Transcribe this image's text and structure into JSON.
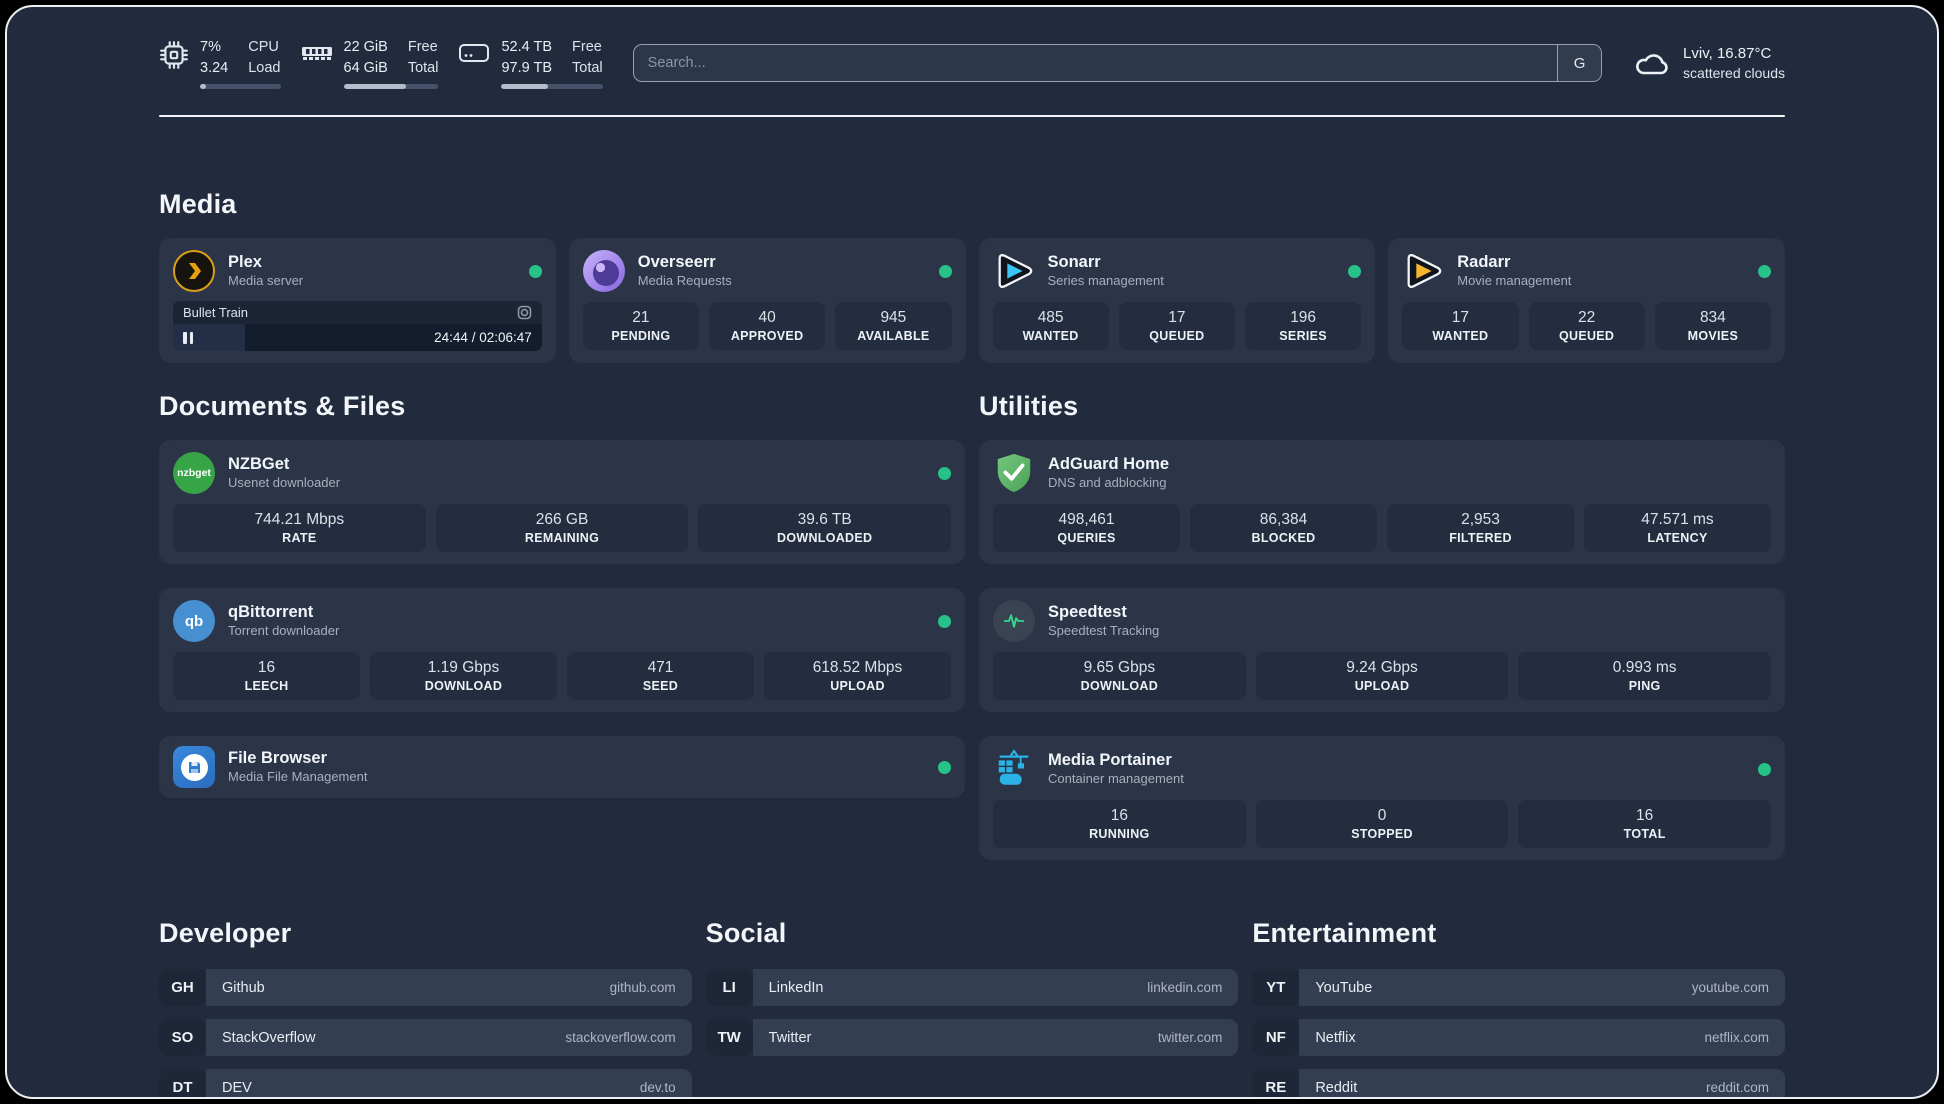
{
  "topbar": {
    "cpu": {
      "value1": "7%",
      "value2": "3.24",
      "label1": "CPU",
      "label2": "Load",
      "progress": 7
    },
    "ram": {
      "value1": "22 GiB",
      "value2": "64 GiB",
      "label1": "Free",
      "label2": "Total",
      "progress": 66
    },
    "disk": {
      "value1": "52.4 TB",
      "value2": "97.9 TB",
      "label1": "Free",
      "label2": "Total",
      "progress": 46
    },
    "search": {
      "placeholder": "Search...",
      "engine_label": "G"
    },
    "weather": {
      "location_temp": "Lviv, 16.87°C",
      "condition": "scattered clouds"
    }
  },
  "sections": {
    "media": {
      "title": "Media",
      "apps": [
        {
          "name": "Plex",
          "desc": "Media server",
          "status": "online",
          "player": {
            "title": "Bullet Train",
            "time": "24:44 / 02:06:47",
            "progress": 19.5
          }
        },
        {
          "name": "Overseerr",
          "desc": "Media Requests",
          "status": "online",
          "stats": [
            {
              "value": "21",
              "label": "PENDING"
            },
            {
              "value": "40",
              "label": "APPROVED"
            },
            {
              "value": "945",
              "label": "AVAILABLE"
            }
          ]
        },
        {
          "name": "Sonarr",
          "desc": "Series management",
          "status": "online",
          "stats": [
            {
              "value": "485",
              "label": "WANTED"
            },
            {
              "value": "17",
              "label": "QUEUED"
            },
            {
              "value": "196",
              "label": "SERIES"
            }
          ]
        },
        {
          "name": "Radarr",
          "desc": "Movie management",
          "status": "online",
          "stats": [
            {
              "value": "17",
              "label": "WANTED"
            },
            {
              "value": "22",
              "label": "QUEUED"
            },
            {
              "value": "834",
              "label": "MOVIES"
            }
          ]
        }
      ]
    },
    "documents": {
      "title": "Documents & Files",
      "apps": [
        {
          "name": "NZBGet",
          "desc": "Usenet downloader",
          "status": "online",
          "stats": [
            {
              "value": "744.21 Mbps",
              "label": "RATE"
            },
            {
              "value": "266 GB",
              "label": "REMAINING"
            },
            {
              "value": "39.6 TB",
              "label": "DOWNLOADED"
            }
          ]
        },
        {
          "name": "qBittorrent",
          "desc": "Torrent downloader",
          "status": "online",
          "stats": [
            {
              "value": "16",
              "label": "LEECH"
            },
            {
              "value": "1.19 Gbps",
              "label": "DOWNLOAD"
            },
            {
              "value": "471",
              "label": "SEED"
            },
            {
              "value": "618.52 Mbps",
              "label": "UPLOAD"
            }
          ]
        },
        {
          "name": "File Browser",
          "desc": "Media File Management",
          "status": "online",
          "stats": []
        }
      ]
    },
    "utilities": {
      "title": "Utilities",
      "apps": [
        {
          "name": "AdGuard Home",
          "desc": "DNS and adblocking",
          "stats": [
            {
              "value": "498,461",
              "label": "QUERIES"
            },
            {
              "value": "86,384",
              "label": "BLOCKED"
            },
            {
              "value": "2,953",
              "label": "FILTERED"
            },
            {
              "value": "47.571 ms",
              "label": "LATENCY"
            }
          ]
        },
        {
          "name": "Speedtest",
          "desc": "Speedtest Tracking",
          "stats": [
            {
              "value": "9.65 Gbps",
              "label": "DOWNLOAD"
            },
            {
              "value": "9.24 Gbps",
              "label": "UPLOAD"
            },
            {
              "value": "0.993 ms",
              "label": "PING"
            }
          ]
        },
        {
          "name": "Media Portainer",
          "desc": "Container management",
          "status": "online",
          "stats": [
            {
              "value": "16",
              "label": "RUNNING"
            },
            {
              "value": "0",
              "label": "STOPPED"
            },
            {
              "value": "16",
              "label": "TOTAL"
            }
          ]
        }
      ]
    },
    "bookmarks": [
      {
        "title": "Developer",
        "links": [
          {
            "abbr": "GH",
            "name": "Github",
            "url": "github.com"
          },
          {
            "abbr": "SO",
            "name": "StackOverflow",
            "url": "stackoverflow.com"
          },
          {
            "abbr": "DT",
            "name": "DEV",
            "url": "dev.to"
          }
        ]
      },
      {
        "title": "Social",
        "links": [
          {
            "abbr": "LI",
            "name": "LinkedIn",
            "url": "linkedin.com"
          },
          {
            "abbr": "TW",
            "name": "Twitter",
            "url": "twitter.com"
          }
        ]
      },
      {
        "title": "Entertainment",
        "links": [
          {
            "abbr": "YT",
            "name": "YouTube",
            "url": "youtube.com"
          },
          {
            "abbr": "NF",
            "name": "Netflix",
            "url": "netflix.com"
          },
          {
            "abbr": "RE",
            "name": "Reddit",
            "url": "reddit.com"
          }
        ]
      }
    ]
  },
  "colors": {
    "status_online": "#27c287",
    "accent_border": "#edf0f4"
  }
}
